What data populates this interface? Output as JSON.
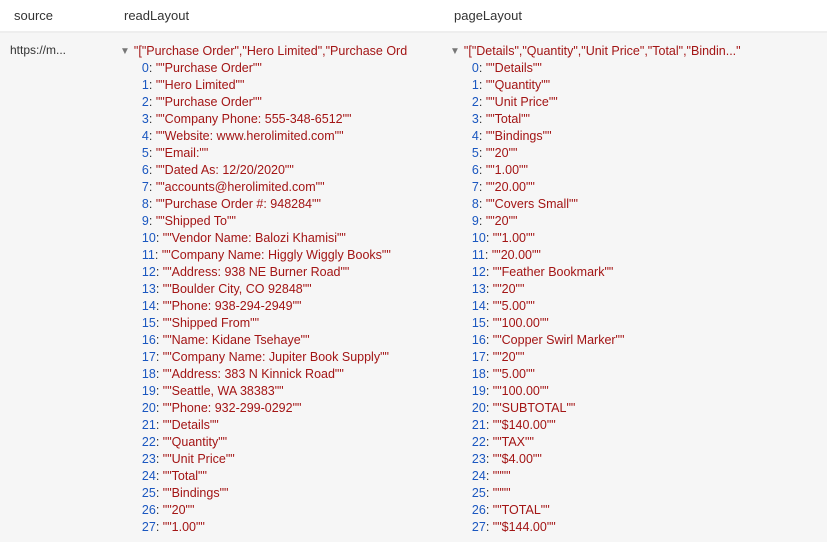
{
  "headers": {
    "source": "source",
    "readLayout": "readLayout",
    "pageLayout": "pageLayout"
  },
  "row": {
    "source": "https://m..."
  },
  "readLayout": {
    "summary": "\"[\"Purchase Order\",\"Hero Limited\",\"Purchase Ord",
    "items": [
      "\"\"Purchase Order\"\"",
      "\"\"Hero Limited\"\"",
      "\"\"Purchase Order\"\"",
      "\"\"Company Phone: 555-348-6512\"\"",
      "\"\"Website: www.herolimited.com\"\"",
      "\"\"Email:\"\"",
      "\"\"Dated As: 12/20/2020\"\"",
      "\"\"accounts@herolimited.com\"\"",
      "\"\"Purchase Order #: 948284\"\"",
      "\"\"Shipped To\"\"",
      "\"\"Vendor Name: Balozi Khamisi\"\"",
      "\"\"Company Name: Higgly Wiggly Books\"\"",
      "\"\"Address: 938 NE Burner Road\"\"",
      "\"\"Boulder City, CO 92848\"\"",
      "\"\"Phone: 938-294-2949\"\"",
      "\"\"Shipped From\"\"",
      "\"\"Name: Kidane Tsehaye\"\"",
      "\"\"Company Name: Jupiter Book Supply\"\"",
      "\"\"Address: 383 N Kinnick Road\"\"",
      "\"\"Seattle, WA 38383\"\"",
      "\"\"Phone: 932-299-0292\"\"",
      "\"\"Details\"\"",
      "\"\"Quantity\"\"",
      "\"\"Unit Price\"\"",
      "\"\"Total\"\"",
      "\"\"Bindings\"\"",
      "\"\"20\"\"",
      "\"\"1.00\"\""
    ]
  },
  "pageLayout": {
    "summary": "\"[\"Details\",\"Quantity\",\"Unit Price\",\"Total\",\"Bindin...\"",
    "items": [
      "\"\"Details\"\"",
      "\"\"Quantity\"\"",
      "\"\"Unit Price\"\"",
      "\"\"Total\"\"",
      "\"\"Bindings\"\"",
      "\"\"20\"\"",
      "\"\"1.00\"\"",
      "\"\"20.00\"\"",
      "\"\"Covers Small\"\"",
      "\"\"20\"\"",
      "\"\"1.00\"\"",
      "\"\"20.00\"\"",
      "\"\"Feather Bookmark\"\"",
      "\"\"20\"\"",
      "\"\"5.00\"\"",
      "\"\"100.00\"\"",
      "\"\"Copper Swirl Marker\"\"",
      "\"\"20\"\"",
      "\"\"5.00\"\"",
      "\"\"100.00\"\"",
      "\"\"SUBTOTAL\"\"",
      "\"\"$140.00\"\"",
      "\"\"TAX\"\"",
      "\"\"$4.00\"\"",
      "\"\"\"\"",
      "\"\"\"\"",
      "\"\"TOTAL\"\"",
      "\"\"$144.00\"\""
    ]
  }
}
